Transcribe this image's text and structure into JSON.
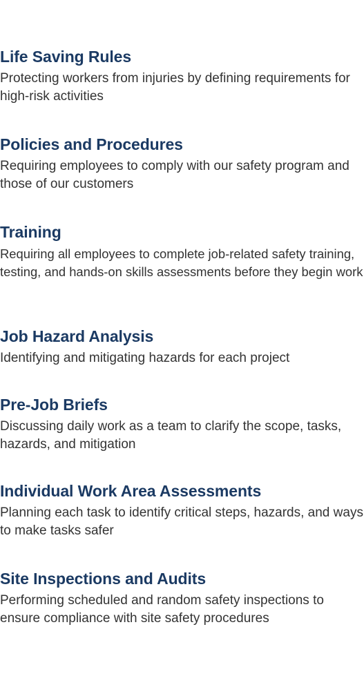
{
  "sections": [
    {
      "title": "Life Saving Rules",
      "description": "Protecting workers from injuries by defining requirements for high-risk activities"
    },
    {
      "title": "Policies and Procedures",
      "description": "Requiring employees to comply with our safety program and those of our customers"
    },
    {
      "title": "Training",
      "description": "Requiring all employees to complete job-related safety training, testing, and hands-on skills assessments before they begin work"
    },
    {
      "title": "Job Hazard Analysis",
      "description": "Identifying and mitigating hazards for each project"
    },
    {
      "title": "Pre-Job Briefs",
      "description": "Discussing daily work as a team to clarify the scope, tasks, hazards, and mitigation"
    },
    {
      "title": "Individual Work Area Assessments",
      "description": "Planning each task to identify critical steps, hazards, and ways to make tasks safer"
    },
    {
      "title": "Site Inspections and Audits",
      "description": "Performing scheduled and random safety inspections to ensure compliance with site safety procedures"
    }
  ]
}
